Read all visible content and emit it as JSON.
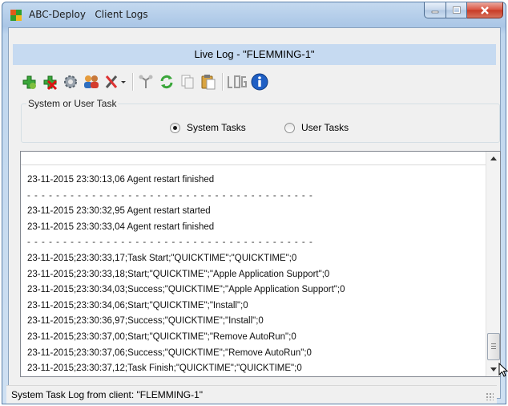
{
  "window": {
    "app_name": "ABC-Deploy",
    "title": "Client Logs",
    "caption_buttons": {
      "minimize": "minimize-icon",
      "maximize": "maximize-icon",
      "close": "close-icon"
    }
  },
  "header": {
    "title": "Live Log - \"FLEMMING-1\""
  },
  "toolbar": {
    "icons": [
      "add-icon",
      "remove-icon",
      "settings-gear-icon",
      "users-icon",
      "tools-icon",
      "network-icon",
      "refresh-icon",
      "copy-icon",
      "paste-icon",
      "log-icon",
      "info-icon"
    ]
  },
  "task_group": {
    "legend": "System or User Task",
    "options": [
      {
        "label": "System Tasks",
        "selected": true
      },
      {
        "label": "User Tasks",
        "selected": false
      }
    ]
  },
  "log": {
    "lines": [
      "23-11-2015 23:30:13,06 Agent restart finished",
      "- - - - - - - - - - - - - - - - - - - - - - - - - - - - - - - - - - - - - - - -",
      "23-11-2015 23:30:32,95 Agent restart started",
      "23-11-2015 23:30:33,04 Agent restart finished",
      "- - - - - - - - - - - - - - - - - - - - - - - - - - - - - - - - - - - - - - - -",
      "23-11-2015;23:30:33,17;Task Start;\"QUICKTIME\";\"QUICKTIME\";0",
      "23-11-2015;23:30:33,18;Start;\"QUICKTIME\";\"Apple Application Support\";0",
      "23-11-2015;23:30:34,03;Success;\"QUICKTIME\";\"Apple Application Support\";0",
      "23-11-2015;23:30:34,06;Start;\"QUICKTIME\";\"Install\";0",
      "23-11-2015;23:30:36,97;Success;\"QUICKTIME\";\"Install\";0",
      "23-11-2015;23:30:37,00;Start;\"QUICKTIME\";\"Remove AutoRun\";0",
      "23-11-2015;23:30:37,06;Success;\"QUICKTIME\";\"Remove AutoRun\";0",
      "23-11-2015;23:30:37,12;Task Finish;\"QUICKTIME\";\"QUICKTIME\";0"
    ]
  },
  "statusbar": {
    "text": "System Task Log from client: \"FLEMMING-1\""
  },
  "colors": {
    "header_band": "#c6daf1",
    "close_button": "#c63a25",
    "window_frame": "#aac6e6"
  }
}
